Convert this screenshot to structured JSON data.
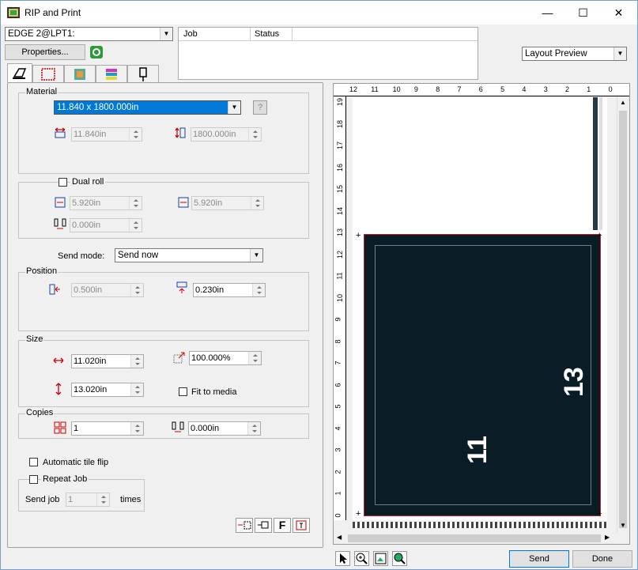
{
  "window": {
    "title": "RIP and Print",
    "minimize": "—",
    "maximize": "☐",
    "close": "✕"
  },
  "printer": {
    "value": "EDGE 2@LPT1:",
    "properties_label": "Properties..."
  },
  "queue": {
    "columns": [
      "Job",
      "Status"
    ]
  },
  "preview_mode": {
    "value": "Layout Preview"
  },
  "material": {
    "label": "Material",
    "value": "11.840 x 1800.000in",
    "width": "11.840in",
    "height": "1800.000in",
    "help": "?"
  },
  "dual_roll": {
    "label": "Dual roll",
    "left": "5.920in",
    "right": "5.920in",
    "gap": "0.000in"
  },
  "send_mode": {
    "label": "Send mode:",
    "value": "Send now"
  },
  "position": {
    "label": "Position",
    "x": "0.500in",
    "y": "0.230in"
  },
  "size": {
    "label": "Size",
    "width": "11.020in",
    "height": "13.020in",
    "scale": "100.000%",
    "fit_label": "Fit to media"
  },
  "copies": {
    "label": "Copies",
    "count": "1",
    "gap": "0.000in"
  },
  "tile_flip": {
    "label": "Automatic tile flip"
  },
  "repeat": {
    "label": "Repeat Job",
    "send_job": "Send job",
    "count": "1",
    "times": "times"
  },
  "bottom_icons": {
    "f": "F"
  },
  "ruler": {
    "top": [
      "12",
      "11",
      "10",
      "9",
      "8",
      "7",
      "6",
      "5",
      "4",
      "3",
      "2",
      "1",
      "0"
    ],
    "left": [
      "19",
      "18",
      "17",
      "16",
      "15",
      "14",
      "13",
      "12",
      "11",
      "10",
      "9",
      "8",
      "7",
      "6",
      "5",
      "4",
      "3",
      "2",
      "1",
      "0"
    ]
  },
  "image": {
    "label_width": "11",
    "label_height": "13"
  },
  "actions": {
    "send": "Send",
    "done": "Done"
  },
  "colors": {
    "image_fill": "#0a1d26",
    "image_border": "#c02020"
  }
}
